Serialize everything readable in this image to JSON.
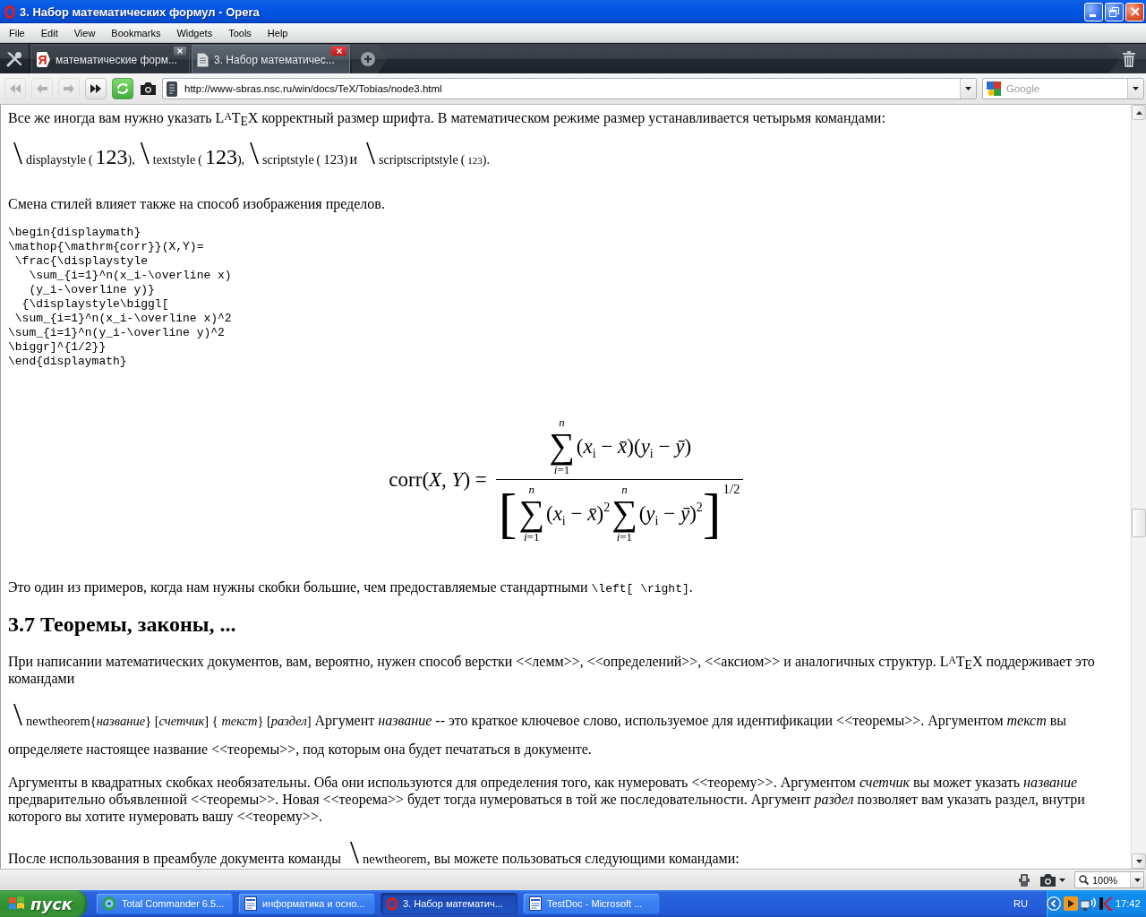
{
  "window": {
    "title": "3. Набор математических формул - Opera"
  },
  "menu": [
    "File",
    "Edit",
    "View",
    "Bookmarks",
    "Widgets",
    "Tools",
    "Help"
  ],
  "tabs": [
    {
      "kind": "site",
      "icon_text": "Я",
      "title": "математические форм...",
      "selected": false
    },
    {
      "kind": "page",
      "title": "3. Набор математичес...",
      "selected": true
    }
  ],
  "toolbar": [
    {
      "kind": "rewind",
      "disabled": true
    },
    {
      "kind": "back",
      "disabled": true
    },
    {
      "kind": "forward",
      "disabled": true
    },
    {
      "kind": "fast-forward",
      "disabled": false
    },
    {
      "kind": "reload",
      "disabled": false
    },
    {
      "kind": "snapshot",
      "disabled": false
    }
  ],
  "address": {
    "url": "http://www-sbras.nsc.ru/win/docs/TeX/Tobias/node3.html"
  },
  "search": {
    "placeholder": "Google"
  },
  "page": [
    {
      "kind": "paragraph",
      "text": "Все же иногда вам нужно указать L$^{A}$T$_{E}$X корректный размер шрифта. В математическом режиме размер устанавливается четырьмя командами:"
    },
    {
      "kind": "styles",
      "items": [
        {
          "kind": "display",
          "backslash": "\\",
          "command": "displaystyle",
          "open": "(",
          "sample": "123",
          "close": "),"
        },
        {
          "kind": "text",
          "backslash": "\\",
          "command": "textstyle",
          "open": "(",
          "sample": "123",
          "close": "),"
        },
        {
          "kind": "script",
          "backslash": "\\",
          "command": "scriptstyle",
          "open": "(",
          "sample": "123",
          "close": ")"
        },
        {
          "kind": "word",
          "text": "и"
        },
        {
          "kind": "scriptscript",
          "backslash": "\\",
          "command": "scriptscriptstyle",
          "open": "(",
          "sample": "123",
          "close": ")."
        }
      ]
    },
    {
      "kind": "paragraph",
      "text": "Смена стилей влияет также на способ изображения пределов."
    },
    {
      "kind": "code",
      "lines": [
        "\\begin{displaymath}",
        "\\mathop{\\mathrm{corr}}(X,Y)=",
        " \\frac{\\displaystyle",
        "   \\sum_{i=1}^n(x_i-\\overline x)",
        "   (y_i-\\overline y)}",
        "  {\\displaystyle\\biggl[",
        " \\sum_{i=1}^n(x_i-\\overline x)^2",
        "\\sum_{i=1}^n(y_i-\\overline y)^2",
        "\\biggr]^{1/2}}",
        "\\end{displaymath}"
      ]
    },
    {
      "kind": "formula",
      "lhs": "corr(*X*, *Y*) =",
      "numerator": [
        {
          "kind": "sum",
          "symbol": "∑",
          "upper": "*n*",
          "lower": "*i*=1"
        },
        {
          "kind": "term",
          "text": "(*x*$_{i}$ − *x̄*)(*y*$_{i}$ − *ȳ*)"
        }
      ],
      "denominator": [
        {
          "kind": "bracket",
          "text": "["
        },
        {
          "kind": "sum",
          "symbol": "∑",
          "upper": "*n*",
          "lower": "*i*=1"
        },
        {
          "kind": "term",
          "text": "(*x*$_{i}$ − *x̄*)$^{2}$"
        },
        {
          "kind": "sum",
          "symbol": "∑",
          "upper": "*n*",
          "lower": "*i*=1"
        },
        {
          "kind": "term",
          "text": "(*y*$_{i}$ − *ȳ*)$^{2}$"
        },
        {
          "kind": "bracket",
          "text": "]"
        },
        {
          "kind": "power",
          "text": "1/2"
        }
      ]
    },
    {
      "kind": "mixed",
      "parts": [
        {
          "kind": "text",
          "text": "Это один из примеров, когда нам нужны скобки большие, чем предоставляемые стандартными "
        },
        {
          "kind": "code",
          "text": "\\left[ \\right]"
        },
        {
          "kind": "text",
          "text": "."
        }
      ]
    },
    {
      "kind": "heading",
      "text": "3.7 Теоремы, законы, ..."
    },
    {
      "kind": "paragraph",
      "text": "При написании математических документов, вам, вероятно, нужен способ верстки <<лемм>>, <<определений>>, <<аксиом>> и аналогичных структур. L$^{A}$T$_{E}$X поддерживает это командами"
    },
    {
      "kind": "command",
      "backslash": "\\",
      "command": "newtheorem{*название*} [*счетчик*] { *текст*} [*раздел*]",
      "after": " Аргумент *название* -- это краткое ключевое слово, используемое для идентификации <<теоремы>>. Аргументом *текст* вы определяете настоящее название <<теоремы>>, под которым она будет печататься в документе."
    },
    {
      "kind": "paragraph",
      "text": "Аргументы в квадратных скобках необязательны. Оба они используются для определения того, как нумеровать <<теорему>>. Аргументом *счетчик* вы может указать *название* предварительно объявленной <<теоремы>>. Новая <<теорема>> будет тогда нумероваться в той же последовательности. Аргумент *раздел* позволяет вам указать раздел, внутри которого вы хотите нумеровать вашу <<теорему>>."
    },
    {
      "kind": "command",
      "before": "После использования в преамбуле документа команды ",
      "backslash": "\\",
      "command": "newtheorem",
      "after": ", вы можете пользоваться следующими командами:"
    }
  ],
  "status_bar": {
    "zoom": "100%"
  },
  "taskbar": {
    "start": "пуск",
    "tasks": [
      {
        "kind": "commander",
        "title": "Total Commander 6.5...",
        "selected": false
      },
      {
        "kind": "document",
        "title": "информатика и осно...",
        "selected": false
      },
      {
        "kind": "browser",
        "title": "3. Набор математич...",
        "selected": true
      },
      {
        "kind": "document",
        "title": "TestDoc - Microsoft ...",
        "selected": false
      }
    ],
    "language": "RU",
    "clock": "17:42"
  }
}
